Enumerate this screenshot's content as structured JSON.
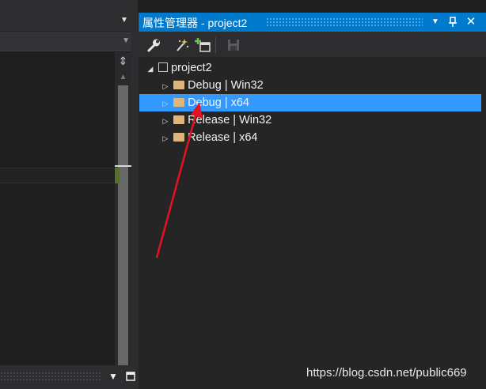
{
  "property_manager": {
    "title": "属性管理器 - project2",
    "title_buttons": {
      "dropdown_icon": "chevron-down-icon",
      "pin_icon": "pin-icon",
      "close_icon": "close-icon"
    },
    "toolbar": [
      {
        "name": "properties-wrench-button",
        "icon": "wrench-icon"
      },
      {
        "name": "add-new-property-sheet-button",
        "icon": "wand-icon"
      },
      {
        "name": "add-existing-property-sheet-button",
        "icon": "add-sheet-icon"
      },
      {
        "name": "save-button",
        "icon": "save-icon",
        "enabled": false
      }
    ],
    "tree": {
      "project": "project2",
      "configurations": [
        {
          "label": "Debug | Win32",
          "selected": false
        },
        {
          "label": "Debug | x64",
          "selected": true
        },
        {
          "label": "Release | Win32",
          "selected": false
        },
        {
          "label": "Release | x64",
          "selected": false
        }
      ]
    }
  },
  "colors": {
    "accent": "#007acc",
    "selection": "#3399ff",
    "annotation_arrow": "#e81123",
    "folder": "#dcb67a"
  },
  "bottom_window": {
    "buttons": [
      "chevron-down-icon",
      "maximize-icon",
      "close-icon"
    ]
  },
  "watermark": "https://blog.csdn.net/public669"
}
